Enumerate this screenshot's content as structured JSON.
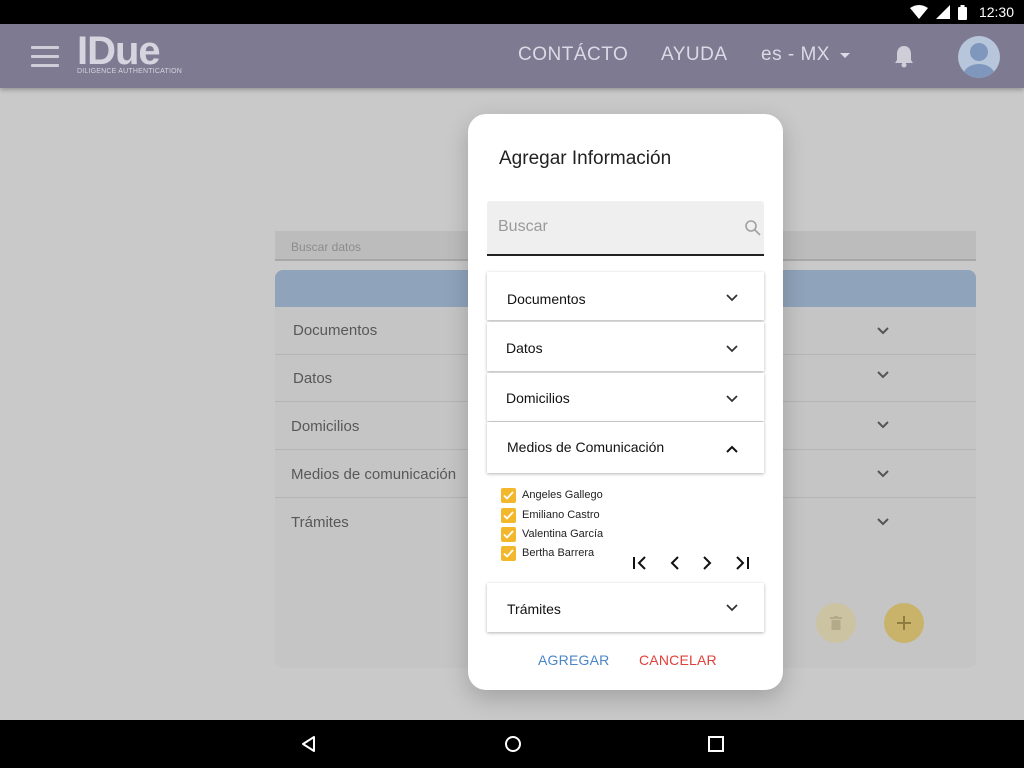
{
  "status_bar": {
    "time": "12:30"
  },
  "header": {
    "logo_text": "IDue",
    "logo_tagline": "DILIGENCE AUTHENTICATION",
    "nav": {
      "contacto": "CONTÁCTO",
      "ayuda": "AYUDA",
      "language": "es - MX"
    },
    "brand_color": "#7d7a92"
  },
  "background": {
    "search_placeholder": "Buscar datos",
    "rows": [
      "Documentos",
      "Datos",
      "Domicilios",
      "Medios de comunicación",
      "Trámites"
    ]
  },
  "dialog": {
    "title": "Agregar Información",
    "search_placeholder": "Buscar",
    "sections": {
      "documentos": "Documentos",
      "datos": "Datos",
      "domicilios": "Domicilios",
      "medios": "Medios de Comunicación",
      "tramites": "Trámites"
    },
    "expanded_section": "Medios de Comunicación",
    "contacts": [
      {
        "name": "Angeles Gallego",
        "checked": true
      },
      {
        "name": "Emiliano Castro",
        "checked": true
      },
      {
        "name": "Valentina García",
        "checked": true
      },
      {
        "name": "Bertha Barrera",
        "checked": true
      }
    ],
    "actions": {
      "agregar": "AGREGAR",
      "cancelar": "CANCELAR"
    },
    "colors": {
      "agregar": "#4a86c8",
      "cancelar": "#e0403a",
      "checkbox": "#f3b72b"
    }
  }
}
